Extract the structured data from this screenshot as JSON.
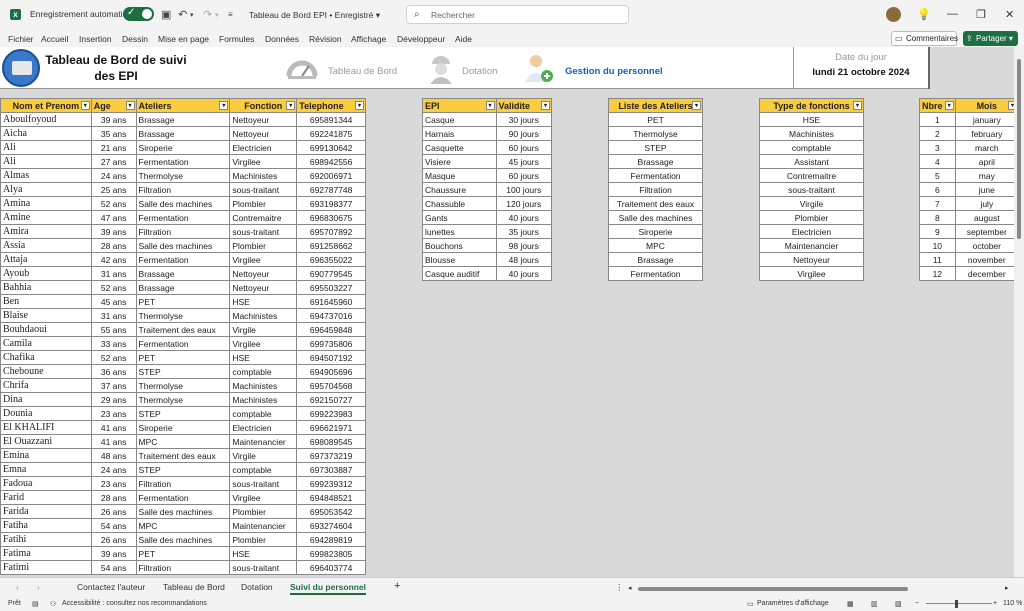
{
  "titlebar": {
    "autosave_label": "Enregistrement automatique",
    "doc_title": "Tableau de Bord EPI • Enregistré ▾",
    "search_placeholder": "Rechercher"
  },
  "menu": [
    "Fichier",
    "Accueil",
    "Insertion",
    "Dessin",
    "Mise en page",
    "Formules",
    "Données",
    "Révision",
    "Affichage",
    "Développeur",
    "Aide"
  ],
  "ribbon": {
    "comments_label": "Commentaires",
    "share_label": "Partager ▾"
  },
  "banner": {
    "title_line1": "Tableau de Bord de suivi",
    "title_line2": "des EPI",
    "nav": [
      {
        "label": "Tableau de Bord",
        "icon": "gauge-icon"
      },
      {
        "label": "Dotation",
        "icon": "worker-helmet-icon"
      },
      {
        "label": "Gestion du personnel",
        "icon": "add-person-icon"
      }
    ],
    "date_label": "Date du jour",
    "date_value": "lundi 21 octobre 2024"
  },
  "personnel": {
    "headers": [
      "Nom et Prenom",
      "Age",
      "Ateliers",
      "Fonction",
      "Telephone"
    ],
    "rows": [
      [
        "Aboulfoyoud",
        "39 ans",
        "Brassage",
        "Nettoyeur",
        "695891344"
      ],
      [
        "Aicha",
        "35 ans",
        "Brassage",
        "Nettoyeur",
        "692241875"
      ],
      [
        "Ali",
        "21 ans",
        "Siroperie",
        "Electricien",
        "699130642"
      ],
      [
        "Ali",
        "27 ans",
        "Fermentation",
        "Virgilee",
        "698942556"
      ],
      [
        "Almas",
        "24 ans",
        "Thermolyse",
        "Machinistes",
        "692006971"
      ],
      [
        "Alya",
        "25 ans",
        "Filtration",
        "sous-traitant",
        "692787748"
      ],
      [
        "Amina",
        "52 ans",
        "Salle des machines",
        "Plombier",
        "693198377"
      ],
      [
        "Amine",
        "47 ans",
        "Fermentation",
        "Contremaitre",
        "696830675"
      ],
      [
        "Amira",
        "39 ans",
        "Filtration",
        "sous-traitant",
        "695707892"
      ],
      [
        "Assia",
        "28 ans",
        "Salle des machines",
        "Plombier",
        "691258662"
      ],
      [
        "Attaja",
        "42 ans",
        "Fermentation",
        "Virgilee",
        "696355022"
      ],
      [
        "Ayoub",
        "31 ans",
        "Brassage",
        "Nettoyeur",
        "690779545"
      ],
      [
        "Bahhia",
        "52 ans",
        "Brassage",
        "Nettoyeur",
        "695503227"
      ],
      [
        "Ben",
        "45 ans",
        "PET",
        "HSE",
        "691645960"
      ],
      [
        "Blaise",
        "31 ans",
        "Thermolyse",
        "Machinistes",
        "694737016"
      ],
      [
        "Bouhdaoui",
        "55 ans",
        "Traitement des eaux",
        "Virgile",
        "696459848"
      ],
      [
        "Camila",
        "33 ans",
        "Fermentation",
        "Virgilee",
        "699735806"
      ],
      [
        "Chafika",
        "52 ans",
        "PET",
        "HSE",
        "694507192"
      ],
      [
        "Cheboune",
        "36 ans",
        "STEP",
        "comptable",
        "694905696"
      ],
      [
        "Chrifa",
        "37 ans",
        "Thermolyse",
        "Machinistes",
        "695704568"
      ],
      [
        "Dina",
        "29 ans",
        "Thermolyse",
        "Machinistes",
        "692150727"
      ],
      [
        "Dounia",
        "23 ans",
        "STEP",
        "comptable",
        "699223983"
      ],
      [
        "El KHALIFI",
        "41 ans",
        "Siroperie",
        "Electricien",
        "696621971"
      ],
      [
        "El Ouazzani",
        "41 ans",
        "MPC",
        "Maintenancier",
        "698089545"
      ],
      [
        "Emina",
        "48 ans",
        "Traitement des eaux",
        "Virgile",
        "697373219"
      ],
      [
        "Emna",
        "24 ans",
        "STEP",
        "comptable",
        "697303887"
      ],
      [
        "Fadoua",
        "23 ans",
        "Filtration",
        "sous-traitant",
        "699239312"
      ],
      [
        "Farid",
        "28 ans",
        "Fermentation",
        "Virgilee",
        "694848521"
      ],
      [
        "Farida",
        "26 ans",
        "Salle des machines",
        "Plombier",
        "695053542"
      ],
      [
        "Fatiha",
        "54 ans",
        "MPC",
        "Maintenancier",
        "693274604"
      ],
      [
        "Fatihi",
        "26 ans",
        "Salle des machines",
        "Plombier",
        "694289819"
      ],
      [
        "Fatima",
        "39 ans",
        "PET",
        "HSE",
        "699823805"
      ],
      [
        "Fatimi",
        "54 ans",
        "Filtration",
        "sous-traitant",
        "696403774"
      ]
    ]
  },
  "epi": {
    "headers": [
      "EPI",
      "Validite"
    ],
    "rows": [
      [
        "Casque",
        "30 jours"
      ],
      [
        "Harnais",
        "90 jours"
      ],
      [
        "Casquette",
        "60 jours"
      ],
      [
        "Visiere",
        "45 jours"
      ],
      [
        "Masque",
        "60 jours"
      ],
      [
        "Chaussure",
        "100 jours"
      ],
      [
        "Chassuble",
        "120 jours"
      ],
      [
        "Gants",
        "40 jours"
      ],
      [
        "lunettes",
        "35 jours"
      ],
      [
        "Bouchons",
        "98 jours"
      ],
      [
        "Blousse",
        "48 jours"
      ],
      [
        "Casque auditif",
        "40 jours"
      ]
    ]
  },
  "ateliers": {
    "header": "Liste des Ateliers",
    "rows": [
      "PET",
      "Thermolyse",
      "STEP",
      "Brassage",
      "Fermentation",
      "Filtration",
      "Traitement des eaux",
      "Salle des machines",
      "Siroperie",
      "MPC",
      "Brassage",
      "Fermentation"
    ]
  },
  "fonctions": {
    "header": "Type de fonctions",
    "rows": [
      "HSE",
      "Machinistes",
      "comptable",
      "Assistant",
      "Contremaitre",
      "sous-traitant",
      "Virgile",
      "Plombier",
      "Electricien",
      "Maintenancier",
      "Nettoyeur",
      "Virgilee"
    ]
  },
  "mois": {
    "headers": [
      "Nbre",
      "Mois"
    ],
    "rows": [
      [
        "1",
        "january"
      ],
      [
        "2",
        "february"
      ],
      [
        "3",
        "march"
      ],
      [
        "4",
        "april"
      ],
      [
        "5",
        "may"
      ],
      [
        "6",
        "june"
      ],
      [
        "7",
        "july"
      ],
      [
        "8",
        "august"
      ],
      [
        "9",
        "september"
      ],
      [
        "10",
        "october"
      ],
      [
        "11",
        "november"
      ],
      [
        "12",
        "december"
      ]
    ]
  },
  "tabs": [
    "Contactez l'auteur",
    "Tableau de Bord",
    "Dotation",
    "Suivi du personnel"
  ],
  "active_tab": "Suivi du personnel",
  "status": {
    "ready": "Prêt",
    "accessibility": "Accessibilité : consultez nos recommandations",
    "display_settings": "Paramètres d'affichage",
    "zoom": "110 %"
  },
  "colors": {
    "header_yellow": "#f9cd3d",
    "excel_green": "#1d6f42",
    "nav_active": "#1a5fb4"
  }
}
